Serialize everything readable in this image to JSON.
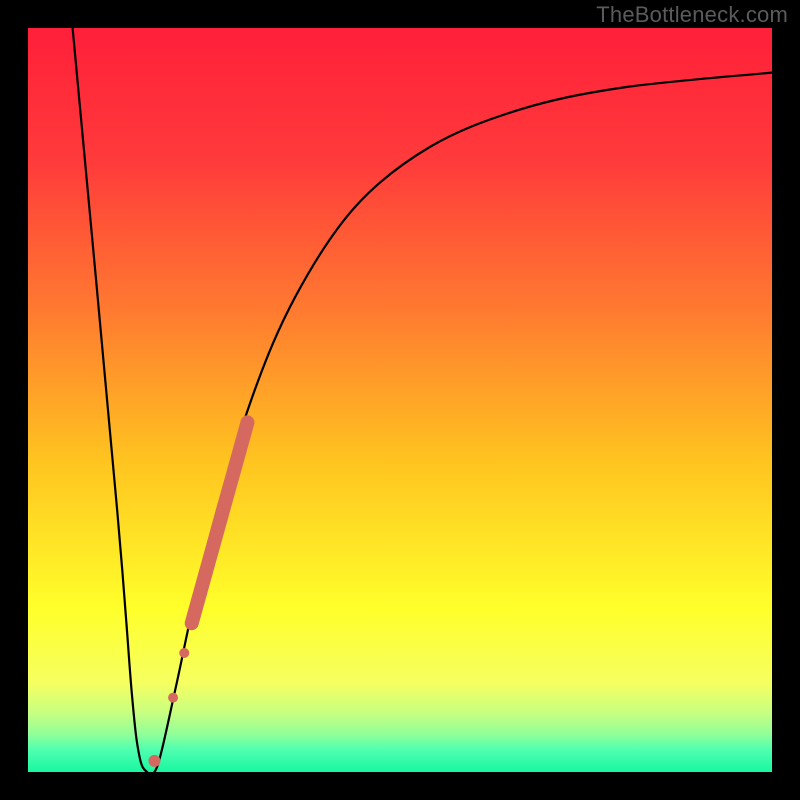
{
  "watermark": "TheBottleneck.com",
  "gradient_stops": [
    {
      "pct": 0,
      "color": "#ff1f3a"
    },
    {
      "pct": 18,
      "color": "#ff3b3b"
    },
    {
      "pct": 38,
      "color": "#ff7a30"
    },
    {
      "pct": 58,
      "color": "#ffc320"
    },
    {
      "pct": 78,
      "color": "#ffff2a"
    },
    {
      "pct": 88,
      "color": "#f6ff60"
    },
    {
      "pct": 92,
      "color": "#c8ff80"
    },
    {
      "pct": 95,
      "color": "#8fff9a"
    },
    {
      "pct": 97,
      "color": "#4fffb0"
    },
    {
      "pct": 100,
      "color": "#18f7a0"
    }
  ],
  "chart_data": {
    "type": "line",
    "title": "",
    "xlabel": "",
    "ylabel": "",
    "xlim": [
      0,
      100
    ],
    "ylim": [
      0,
      100
    ],
    "curve": [
      {
        "x": 6,
        "y": 100
      },
      {
        "x": 12,
        "y": 35
      },
      {
        "x": 14,
        "y": 10
      },
      {
        "x": 15,
        "y": 2
      },
      {
        "x": 16,
        "y": 0
      },
      {
        "x": 17,
        "y": 0
      },
      {
        "x": 18,
        "y": 3
      },
      {
        "x": 20,
        "y": 12
      },
      {
        "x": 24,
        "y": 30
      },
      {
        "x": 30,
        "y": 50
      },
      {
        "x": 36,
        "y": 64
      },
      {
        "x": 44,
        "y": 76
      },
      {
        "x": 54,
        "y": 84
      },
      {
        "x": 66,
        "y": 89
      },
      {
        "x": 80,
        "y": 92
      },
      {
        "x": 100,
        "y": 94
      }
    ],
    "markers": [
      {
        "x": 17.0,
        "y": 1.5,
        "r": 6,
        "color": "#d6695f"
      },
      {
        "x": 19.5,
        "y": 10.0,
        "r": 5,
        "color": "#d6695f"
      },
      {
        "x": 21.0,
        "y": 16.0,
        "r": 5,
        "color": "#d6695f"
      }
    ],
    "thick_segment": {
      "start": {
        "x": 22.0,
        "y": 20.0
      },
      "end": {
        "x": 29.5,
        "y": 47.0
      },
      "width": 14,
      "color": "#d6695f"
    }
  }
}
